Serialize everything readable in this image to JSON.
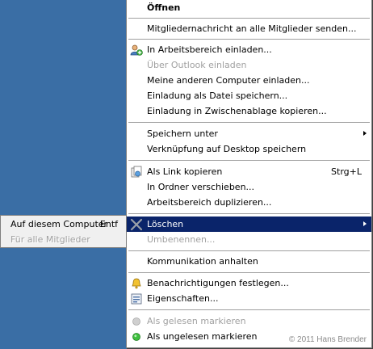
{
  "menu": {
    "open": "Öffnen",
    "send_message": "Mitgliedernachricht an alle Mitglieder senden...",
    "invite_workspace": "In Arbeitsbereich einladen...",
    "invite_outlook": "Über Outlook einladen",
    "invite_other_computers": "Meine anderen Computer einladen...",
    "save_invite_file": "Einladung als Datei speichern...",
    "copy_invite_clipboard": "Einladung in Zwischenablage kopieren...",
    "save_as": "Speichern unter",
    "desktop_shortcut": "Verknüpfung auf Desktop speichern",
    "copy_link": "Als Link kopieren",
    "copy_link_shortcut": "Strg+L",
    "move_to_folder": "In Ordner verschieben...",
    "duplicate_workspace": "Arbeitsbereich duplizieren...",
    "delete": "Löschen",
    "rename": "Umbenennen...",
    "pause_communication": "Kommunikation anhalten",
    "set_notifications": "Benachrichtigungen festlegen...",
    "properties": "Eigenschaften...",
    "mark_read": "Als gelesen markieren",
    "mark_unread": "Als ungelesen markieren"
  },
  "submenu": {
    "this_computer": "Auf diesem Computer",
    "this_computer_shortcut": "Entf",
    "all_members": "Für alle Mitglieder"
  },
  "copyright": "© 2011 Hans Brender",
  "colors": {
    "desktop": "#3a6ea5",
    "highlight": "#0a246a",
    "menu_bg": "#ffffff",
    "disabled": "#a0a0a0"
  }
}
